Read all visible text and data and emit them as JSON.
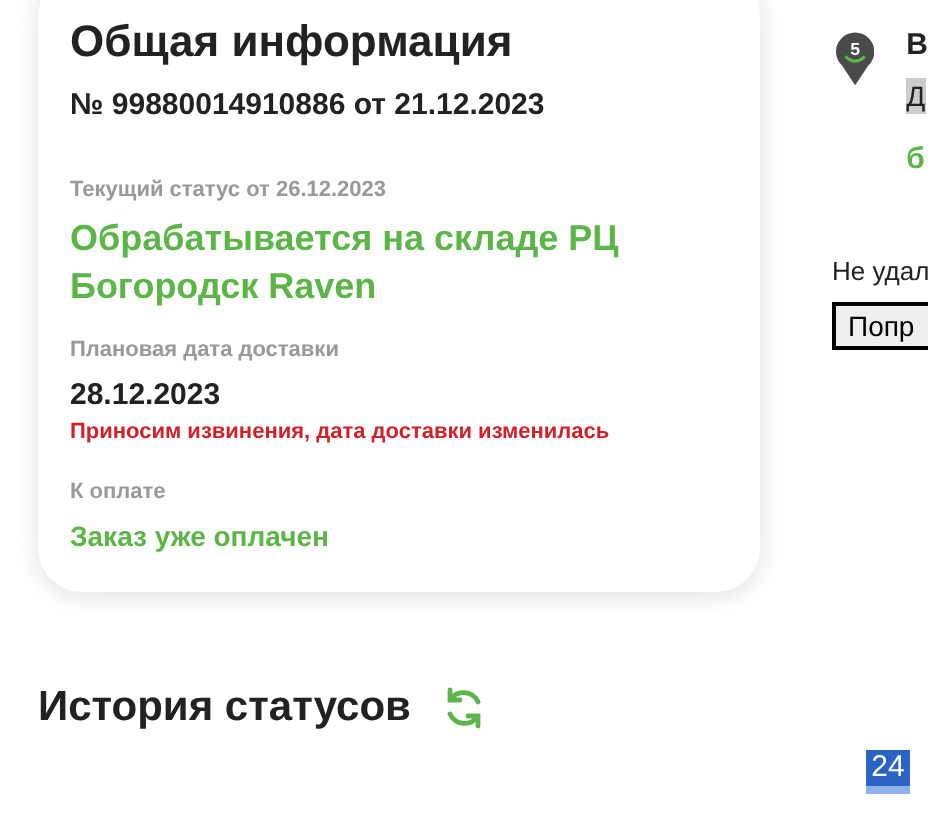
{
  "info": {
    "title": "Общая информация",
    "order_number": "№ 99880014910886 от 21.12.2023",
    "status_label": "Текущий статус от 26.12.2023",
    "status": "Обрабатывается на складе РЦ Богородск Raven",
    "delivery_label": "Плановая дата доставки",
    "delivery_date": "28.12.2023",
    "delivery_note": "Приносим извинения, дата доставки изменилась",
    "payment_label": "К оплате",
    "payment_status": "Заказ уже оплачен"
  },
  "history": {
    "title": "История статусов"
  },
  "side": {
    "step": "5",
    "title_fragment": "В",
    "subtitle_fragment": "Д",
    "green_fragment": "б",
    "notice_fragment": "Не удал",
    "button_fragment": "Попр"
  },
  "badge": "24"
}
